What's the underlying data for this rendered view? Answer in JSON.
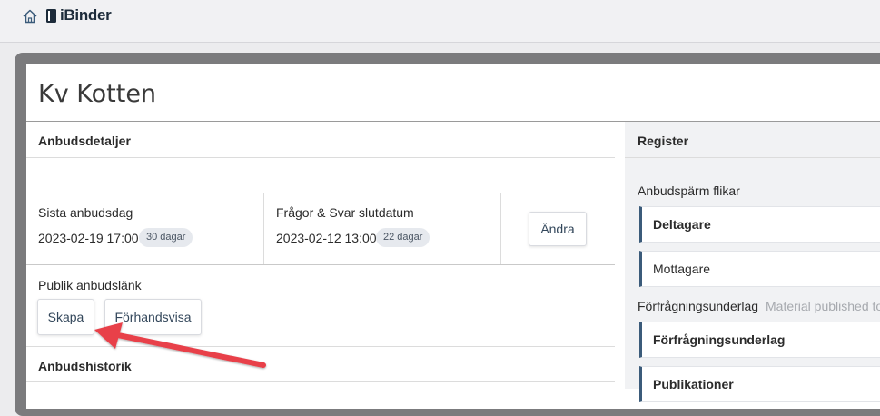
{
  "header": {
    "logo_text": "iBinder",
    "home_icon": "home-icon"
  },
  "page": {
    "title": "Kv Kotten"
  },
  "details": {
    "heading": "Anbudsdetaljer",
    "deadline_label": "Sista anbudsdag",
    "deadline_value": "2023-02-19 17:00",
    "deadline_badge": "30 dagar",
    "qa_label": "Frågor & Svar slutdatum",
    "qa_value": "2023-02-12 13:00",
    "qa_badge": "22 dagar",
    "edit_label": "Ändra"
  },
  "public_link": {
    "label": "Publik anbudslänk",
    "create_label": "Skapa",
    "preview_label": "Förhandsvisa"
  },
  "history": {
    "heading": "Anbudshistorik"
  },
  "register": {
    "heading": "Register",
    "binder_tabs_label": "Anbudspärm flikar",
    "tabs": [
      "Deltagare",
      "Mottagare"
    ],
    "docs_label": "Förfrågningsunderlag",
    "docs_note": "Material published to",
    "doc_tabs": [
      "Förfrågningsunderlag",
      "Publikationer"
    ]
  },
  "annotation": {
    "arrow_color": "#e8404a"
  }
}
